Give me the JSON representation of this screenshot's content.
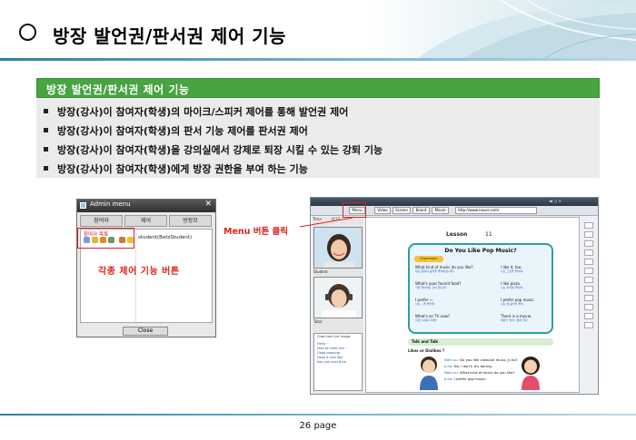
{
  "header": {
    "title": "방장 발언권/판서권 제어 기능"
  },
  "section": {
    "bar_title": "방장 발언권/판서권 제어 기능",
    "bullets": [
      "방장(강사)이 참여자(학생)의 마이크/스피커 제어를 통해 발언권 제어",
      "방장(강사)이 참여자(학생)의 판서 기능 제어를 판서권 제어",
      "방장(강사)이 참여자(학생)을 강의실에서 강제로 퇴장 시킬 수 있는 강퇴 기능",
      "방장(강사)이 참여자(학생)에게 방장 권한을 부여 하는 기능"
    ]
  },
  "admin_menu": {
    "title": "Admin menu",
    "tabs": [
      "참여자",
      "제어",
      "방장모"
    ],
    "panel_label": "참여자 목록",
    "student": "student(BetsStudent)",
    "close_label": "Close",
    "callout": "각종 제어 기능 버튼"
  },
  "menu_callout": "Menu 버튼 클릭",
  "app": {
    "toolbar": [
      "Menu",
      "Video",
      "Screen",
      "Board",
      "Movie"
    ],
    "address": "http://www.naver.com/",
    "left": {
      "time_label": "Time",
      "time_value": "0:13",
      "student_label": "Student",
      "tutor_label": "Tutor",
      "chat_tabs": "Chat   User List  Image",
      "chat_lines": [
        "Hello ~",
        "Nice to meet you ~",
        "Good morning",
        "Have a nice day",
        "See you next time"
      ]
    },
    "lesson": {
      "label": "Lesson",
      "number": "11",
      "title": "Do You Like Pop Music?",
      "expression": "Expression",
      "rows": [
        {
          "q": "What kind of music do you like?",
          "qk": "무슨 종류의 음악을 좋아하십니까?",
          "a": "I like it, too.",
          "ak": "나도 그것을 좋아해."
        },
        {
          "q": "What's your favorit food?",
          "qk": "가장 좋아하는 것이 뭡니까?",
          "a": "I like pizza.",
          "ak": "나는 피자를 좋아해."
        },
        {
          "q": "I prefer ~.",
          "qk": "나는 ~을 좋아해.",
          "a": "I prefer pop music.",
          "ak": "나는 팝 음악이 좋아."
        },
        {
          "q": "What's on TV now?",
          "qk": "지금 TV에서 뭐해?",
          "a": "There is a movie.",
          "ak": "영화가 있어 / 영화 한다."
        }
      ],
      "talk_title": "Talk and Talk",
      "likes": "Likes or Dislikes ?",
      "dialog": [
        {
          "n": "Nam-su:",
          "t": "Do you like classical music, Ji-ho?"
        },
        {
          "n": "Ji-ho:",
          "t": "No, I don't. It's boring."
        },
        {
          "n": "Nam-su:",
          "t": "What kind of music do you like?"
        },
        {
          "n": "Ji-ho:",
          "t": "I prefer pop music."
        }
      ]
    }
  },
  "footer": {
    "page": "26 page"
  }
}
